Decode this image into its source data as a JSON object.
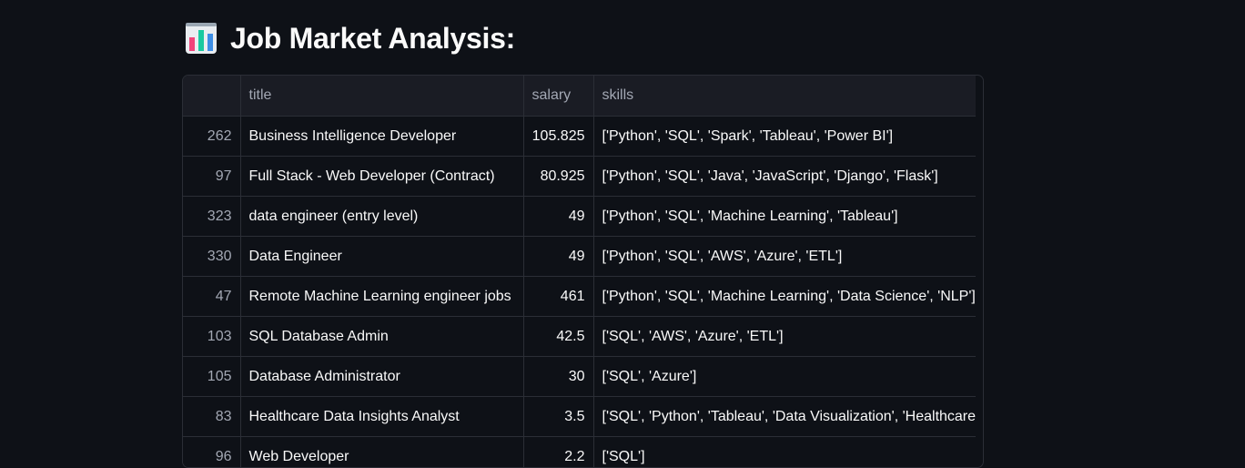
{
  "heading": {
    "icon": "bar-chart-emoji-icon",
    "text": "Job Market Analysis:"
  },
  "table": {
    "columns": [
      "",
      "title",
      "salary",
      "skills"
    ],
    "rows": [
      {
        "index": "262",
        "title": "Business Intelligence Developer",
        "salary": "105.825",
        "skills": "['Python', 'SQL', 'Spark', 'Tableau', 'Power BI']"
      },
      {
        "index": "97",
        "title": "Full Stack - Web Developer (Contract)",
        "salary": "80.925",
        "skills": "['Python', 'SQL', 'Java', 'JavaScript', 'Django', 'Flask']"
      },
      {
        "index": "323",
        "title": "data engineer (entry level)",
        "salary": "49",
        "skills": "['Python', 'SQL', 'Machine Learning', 'Tableau']"
      },
      {
        "index": "330",
        "title": "Data Engineer",
        "salary": "49",
        "skills": "['Python', 'SQL', 'AWS', 'Azure', 'ETL']"
      },
      {
        "index": "47",
        "title": "Remote Machine Learning engineer jobs",
        "salary": "461",
        "skills": "['Python', 'SQL', 'Machine Learning', 'Data Science', 'NLP']"
      },
      {
        "index": "103",
        "title": "SQL Database Admin",
        "salary": "42.5",
        "skills": "['SQL', 'AWS', 'Azure', 'ETL']"
      },
      {
        "index": "105",
        "title": "Database Administrator",
        "salary": "30",
        "skills": "['SQL', 'Azure']"
      },
      {
        "index": "83",
        "title": "Healthcare Data Insights Analyst",
        "salary": "3.5",
        "skills": "['SQL', 'Python', 'Tableau', 'Data Visualization', 'Healthcare"
      },
      {
        "index": "96",
        "title": "Web Developer",
        "salary": "2.2",
        "skills": "['SQL']"
      }
    ]
  }
}
